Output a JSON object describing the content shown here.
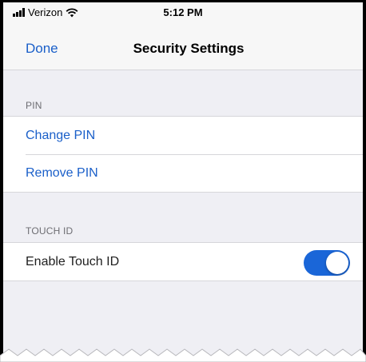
{
  "status_bar": {
    "carrier": "Verizon",
    "time": "5:12 PM",
    "icons": [
      "signal-icon",
      "wifi-icon"
    ]
  },
  "nav": {
    "done_label": "Done",
    "title": "Security Settings"
  },
  "sections": {
    "pin": {
      "header": "PIN",
      "items": [
        {
          "label": "Change PIN"
        },
        {
          "label": "Remove PIN"
        }
      ]
    },
    "touch_id": {
      "header": "TOUCH ID",
      "items": [
        {
          "label": "Enable Touch ID",
          "toggle_on": true
        }
      ]
    }
  },
  "colors": {
    "accent": "#1a5fc9",
    "toggle_on": "#1a66d8",
    "background": "#efeff4"
  }
}
